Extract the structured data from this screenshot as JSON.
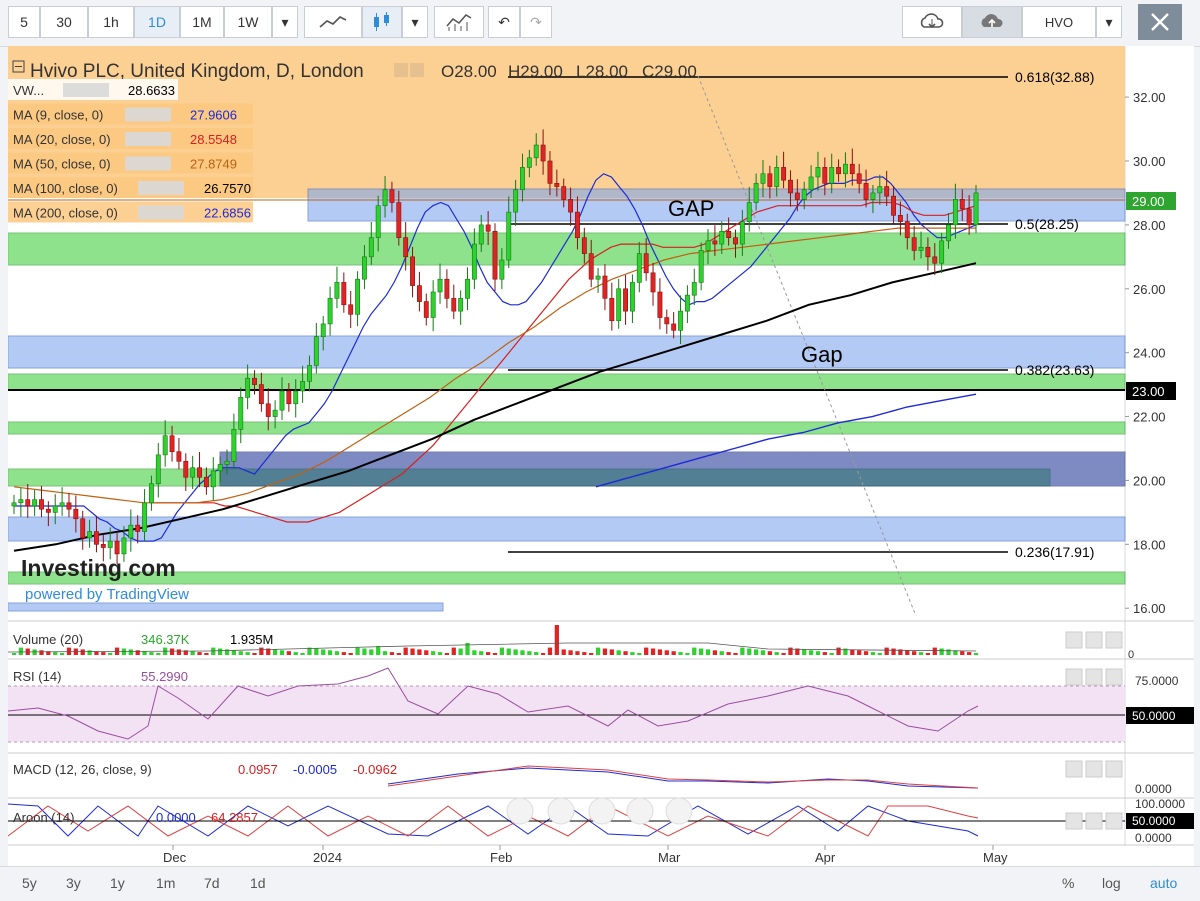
{
  "toolbar": {
    "intervals": [
      "5",
      "30",
      "1h",
      "1D",
      "1M",
      "1W"
    ],
    "selected_interval": "1D",
    "symbol": "HVO"
  },
  "legend": {
    "title": "Hvivo PLC, United Kingdom, D, London",
    "open": "O28.00",
    "high": "H29.00",
    "low": "L28.00",
    "close": "C29.00",
    "indicators": [
      {
        "label": "VW...",
        "value": "28.6633",
        "color": "#000000"
      },
      {
        "label": "MA (9, close, 0)",
        "value": "27.9606",
        "color": "#1d2bd6"
      },
      {
        "label": "MA (20, close, 0)",
        "value": "28.5548",
        "color": "#d62020"
      },
      {
        "label": "MA (50, close, 0)",
        "value": "27.8749",
        "color": "#c06010"
      },
      {
        "label": "MA (100, close, 0)",
        "value": "26.7570",
        "color": "#000000"
      },
      {
        "label": "MA (200, close, 0)",
        "value": "22.6856",
        "color": "#1d2bd6"
      }
    ]
  },
  "annotations": {
    "gap_upper": "GAP",
    "gap_lower": "Gap",
    "fib_618": "0.618(32.88)",
    "fib_500": "0.5(28.25)",
    "fib_382": "0.382(23.63)",
    "fib_236": "0.236(17.91)"
  },
  "branding": {
    "logo": "Investing.com",
    "powered": "powered by TradingView"
  },
  "price_axis": {
    "ticks": [
      "32.00",
      "30.00",
      "28.00",
      "26.00",
      "24.00",
      "22.00",
      "20.00",
      "18.00",
      "16.00"
    ],
    "last_price_tag": "29.00",
    "level_tag": "23.00"
  },
  "time_axis": {
    "labels": [
      "Dec",
      "2024",
      "Feb",
      "Mar",
      "Apr",
      "May"
    ]
  },
  "panes": {
    "volume": {
      "label": "Volume (20)",
      "value1": "346.37K",
      "value2": "1.935M",
      "axis": "0"
    },
    "rsi": {
      "label": "RSI (14)",
      "value": "55.2990",
      "ticks": [
        "75.0000",
        "50.0000"
      ]
    },
    "macd": {
      "label": "MACD (12, 26, close, 9)",
      "v1": "0.0957",
      "v2": "-0.0005",
      "v3": "-0.0962",
      "tick": "0.0000"
    },
    "aroon": {
      "label": "Aroon (14)",
      "v1": "0.0000",
      "v2": "64.2857",
      "ticks": [
        "100.0000",
        "50.0000",
        "0.0000"
      ]
    }
  },
  "bottom": {
    "ranges": [
      "5y",
      "3y",
      "1y",
      "1m",
      "7d",
      "1d"
    ],
    "options": [
      "%",
      "log",
      "auto"
    ],
    "active_option": "auto"
  },
  "chart_data": {
    "type": "candlestick",
    "title": "Hvivo PLC, United Kingdom, D, London",
    "ylim": [
      15.6,
      33.6
    ],
    "x_ticks": [
      "Dec",
      "2024",
      "Feb",
      "Mar",
      "Apr",
      "May"
    ],
    "closes": [
      19.3,
      19.4,
      19.2,
      19.4,
      19.1,
      19.0,
      19.2,
      19.3,
      19.1,
      18.8,
      18.2,
      18.4,
      18.0,
      17.9,
      18.1,
      17.7,
      18.2,
      18.6,
      18.4,
      19.3,
      19.9,
      20.8,
      21.4,
      20.9,
      20.6,
      20.1,
      20.4,
      20.1,
      19.8,
      20.3,
      20.5,
      20.6,
      21.6,
      22.6,
      23.2,
      23.0,
      22.4,
      22.0,
      22.2,
      22.8,
      22.4,
      22.8,
      23.1,
      23.6,
      24.5,
      24.9,
      25.7,
      26.2,
      25.5,
      25.2,
      26.3,
      27.0,
      27.6,
      28.6,
      29.1,
      28.7,
      27.6,
      27.0,
      26.1,
      25.6,
      25.1,
      25.9,
      26.3,
      25.7,
      25.3,
      25.7,
      26.3,
      27.4,
      28.0,
      27.8,
      26.3,
      26.9,
      28.4,
      29.1,
      29.8,
      30.1,
      30.5,
      30.0,
      29.3,
      29.2,
      28.8,
      28.4,
      27.6,
      27.1,
      26.3,
      26.4,
      25.7,
      25.0,
      26.0,
      25.3,
      26.2,
      27.1,
      26.5,
      25.9,
      25.1,
      24.9,
      24.7,
      25.3,
      25.8,
      26.2,
      27.2,
      27.5,
      27.4,
      27.8,
      27.6,
      27.4,
      28.1,
      28.7,
      29.3,
      29.6,
      29.2,
      29.8,
      29.4,
      29.0,
      28.8,
      29.1,
      29.5,
      29.8,
      29.3,
      29.8,
      29.6,
      29.9,
      29.6,
      29.3,
      28.8,
      29.0,
      29.2,
      28.9,
      28.3,
      28.1,
      27.6,
      27.2,
      27.3,
      27.0,
      26.8,
      27.5,
      28.0,
      28.8,
      28.5,
      28.0,
      29.0
    ],
    "series": [
      {
        "name": "MA (9, close, 0)",
        "values": [
          19.2,
          19.2,
          19.2,
          19.2,
          19.2,
          19.2,
          19.2,
          19.2,
          19.2,
          19.2,
          19.0,
          18.8,
          18.7,
          18.5,
          18.4,
          18.2,
          18.1,
          18.1,
          18.1,
          18.2,
          18.6,
          19.0,
          19.3,
          19.6,
          19.9,
          20.1,
          20.3,
          20.4,
          20.4,
          20.4,
          20.3,
          20.2,
          20.5,
          20.8,
          21.1,
          21.4,
          21.6,
          21.7,
          21.8,
          22.1,
          22.4,
          22.8,
          23.3,
          23.8,
          24.3,
          24.8,
          25.2,
          25.5,
          25.8,
          26.2,
          26.7,
          27.3,
          27.9,
          28.4,
          28.6,
          28.7,
          28.6,
          28.2,
          27.8,
          27.3,
          26.7,
          26.2,
          25.9,
          25.6,
          25.5,
          25.5,
          25.6,
          25.9,
          26.2,
          26.6,
          27.0,
          27.4,
          27.8,
          28.3,
          28.9,
          29.4,
          29.6,
          29.5,
          29.2,
          28.9,
          28.5,
          28.0,
          27.4,
          26.9,
          26.4,
          26.0,
          25.7,
          25.5,
          25.6,
          25.6,
          25.7,
          25.9,
          26.1,
          26.3,
          26.5,
          26.7,
          27.0,
          27.3,
          27.6,
          27.9,
          28.2,
          28.6,
          28.9,
          29.1,
          29.2,
          29.3,
          29.3,
          29.3,
          29.4,
          29.4,
          29.4,
          29.5,
          29.5,
          29.3,
          29.0,
          28.7,
          28.3,
          28.0,
          27.8,
          27.6,
          27.6,
          27.7,
          27.8,
          27.9,
          28.0
        ]
      },
      {
        "name": "MA (20, close, 0)",
        "values": [
          19.3,
          19.3,
          19.3,
          19.3,
          19.3,
          19.3,
          19.3,
          19.2,
          19.2,
          19.1,
          19.0,
          18.9,
          18.8,
          18.7,
          18.7,
          18.7,
          18.8,
          18.9,
          19.0,
          19.2,
          19.4,
          19.6,
          19.8,
          20.0,
          20.2,
          20.5,
          20.8,
          21.1,
          21.5,
          21.9,
          22.3,
          22.7,
          23.1,
          23.5,
          23.9,
          24.3,
          24.7,
          25.1,
          25.5,
          25.9,
          26.3,
          26.6,
          26.9,
          27.1,
          27.3,
          27.4,
          27.4,
          27.4,
          27.4,
          27.3,
          27.3,
          27.3,
          27.3,
          27.4,
          27.6,
          27.8,
          28.0,
          28.2,
          28.4,
          28.5,
          28.6,
          28.6,
          28.6,
          28.6,
          28.6,
          28.6,
          28.6,
          28.6,
          28.6,
          28.7,
          28.7,
          28.7,
          28.6,
          28.4,
          28.3,
          28.3,
          28.3,
          28.4,
          28.5,
          28.6
        ]
      },
      {
        "name": "MA (50, close, 0)",
        "values": [
          19.8,
          19.7,
          19.6,
          19.5,
          19.4,
          19.3,
          19.3,
          19.3,
          19.4,
          19.6,
          19.9,
          20.2,
          20.6,
          21.1,
          21.6,
          22.1,
          22.6,
          23.2,
          23.7,
          24.3,
          24.8,
          25.4,
          25.9,
          26.3,
          26.6,
          26.9,
          27.1,
          27.2,
          27.3,
          27.4,
          27.5,
          27.6,
          27.7,
          27.8,
          27.9,
          27.9,
          27.9,
          27.9
        ]
      },
      {
        "name": "MA (100, close, 0)",
        "values": [
          17.8,
          18.0,
          18.3,
          18.5,
          18.8,
          19.1,
          19.5,
          19.9,
          20.3,
          20.8,
          21.3,
          21.9,
          22.4,
          22.9,
          23.4,
          23.8,
          24.2,
          24.6,
          25.0,
          25.5,
          25.8,
          26.2,
          26.5,
          26.8
        ]
      },
      {
        "name": "MA (200, close, 0)",
        "values": [
          19.8,
          20.1,
          20.4,
          20.7,
          21.0,
          21.3,
          21.5,
          21.8,
          22.0,
          22.3,
          22.5,
          22.7
        ]
      }
    ]
  }
}
